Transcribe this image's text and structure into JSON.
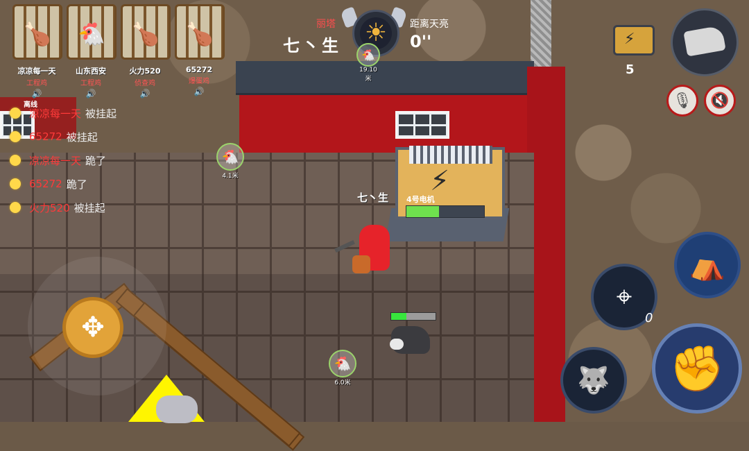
{
  "team": [
    {
      "name": "凉凉每一天",
      "role": "工程鸡",
      "portrait_icon": "roast-chicken-icon",
      "sound_icon": "speaker-icon"
    },
    {
      "name": "山东西安",
      "role": "工程鸡",
      "portrait_icon": "chicken-icon",
      "sound_icon": "speaker-icon"
    },
    {
      "name": "火力520",
      "role": "侦查鸡",
      "portrait_icon": "roast-chicken-icon",
      "sound_icon": "speaker-icon"
    },
    {
      "name": "65272",
      "role": "爆蛋鸡",
      "portrait_icon": "roast-chicken-icon",
      "sound_icon": "speaker-icon"
    }
  ],
  "offline_label": "离线",
  "feed": [
    {
      "name": "凉凉每一天",
      "action": "被挂起"
    },
    {
      "name": "65272",
      "action": "被挂起"
    },
    {
      "name": "凉凉每一天",
      "action": "跪了"
    },
    {
      "name": "65272",
      "action": "跪了"
    },
    {
      "name": "火力520",
      "action": "被挂起"
    }
  ],
  "hud": {
    "boss_name": "丽塔",
    "self_name": "七丶生",
    "dawn_label": "距离天亮",
    "dawn_time": "0''",
    "top_marker_distance": "19.10米"
  },
  "generator": {
    "label": "4号电机",
    "progress": 0.42,
    "count": "5"
  },
  "world": {
    "player_tag": "七丶生",
    "marker_left_distance": "4.1米",
    "marker_bottom_distance": "6.0米",
    "wolf_hp": 0.35
  },
  "skills": {
    "aim_count": "0"
  },
  "colors": {
    "enemy_red": "#ff3a3a",
    "feed_dot": "#ffd84a",
    "progress_green": "#6fe04e",
    "skill_blue": "#1f3f75"
  }
}
